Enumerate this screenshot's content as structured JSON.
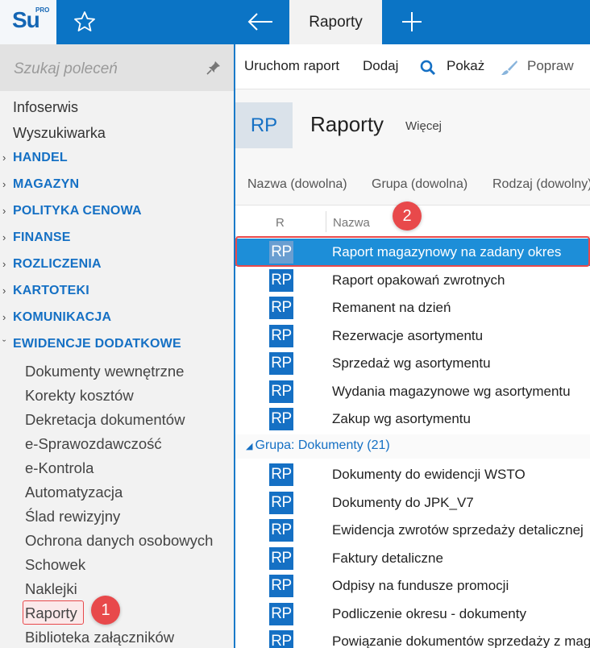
{
  "app": {
    "logo_text": "Su",
    "logo_sup": "PRO"
  },
  "topbar": {
    "active_tab": "Raporty"
  },
  "sidebar": {
    "search_placeholder": "Szukaj poleceń",
    "links": [
      "Infoserwis",
      "Wyszukiwarka"
    ],
    "categories": [
      "HANDEL",
      "MAGAZYN",
      "POLITYKA CENOWA",
      "FINANSE",
      "ROZLICZENIA",
      "KARTOTEKI",
      "KOMUNIKACJA"
    ],
    "expanded_category": "EWIDENCJE DODATKOWE",
    "sub_items": [
      "Dokumenty wewnętrzne",
      "Korekty kosztów",
      "Dekretacja dokumentów",
      "e-Sprawozdawczość",
      "e-Kontrola",
      "Automatyzacja",
      "Ślad rewizyjny",
      "Ochrona danych osobowych",
      "Schowek",
      "Naklejki",
      "Raporty",
      "Biblioteka załączników"
    ],
    "step_badge": "1"
  },
  "toolbar": {
    "run": "Uruchom raport",
    "add": "Dodaj",
    "show": "Pokaż",
    "edit": "Popraw"
  },
  "header": {
    "logo": "RP",
    "title": "Raporty",
    "more": "Więcej"
  },
  "filters": [
    "Nazwa (dowolna)",
    "Grupa (dowolna)",
    "Rodzaj (dowolny)"
  ],
  "grid": {
    "col_r": "R",
    "col_name": "Nazwa",
    "step_badge": "2",
    "icon_label": "RP",
    "rows_top": [
      "Raport magazynowy na zadany okres",
      "Raport opakowań zwrotnych",
      "Remanent na dzień",
      "Rezerwacje asortymentu",
      "Sprzedaż wg asortymentu",
      "Wydania magazynowe wg asortymentu",
      "Zakup wg asortymentu"
    ],
    "group_label": "Grupa: Dokumenty (21)",
    "rows_group": [
      "Dokumenty do ewidencji WSTO",
      "Dokumenty do JPK_V7",
      "Ewidencja zwrotów sprzedaży detalicznej",
      "Faktury detaliczne",
      "Odpisy na fundusze promocji",
      "Podliczenie okresu - dokumenty",
      "Powiązanie dokumentów sprzedaży z magazynowymi"
    ]
  },
  "colors": {
    "accent": "#0b74c5",
    "highlight": "#e8494b",
    "selected_row": "#1d8ed8"
  }
}
